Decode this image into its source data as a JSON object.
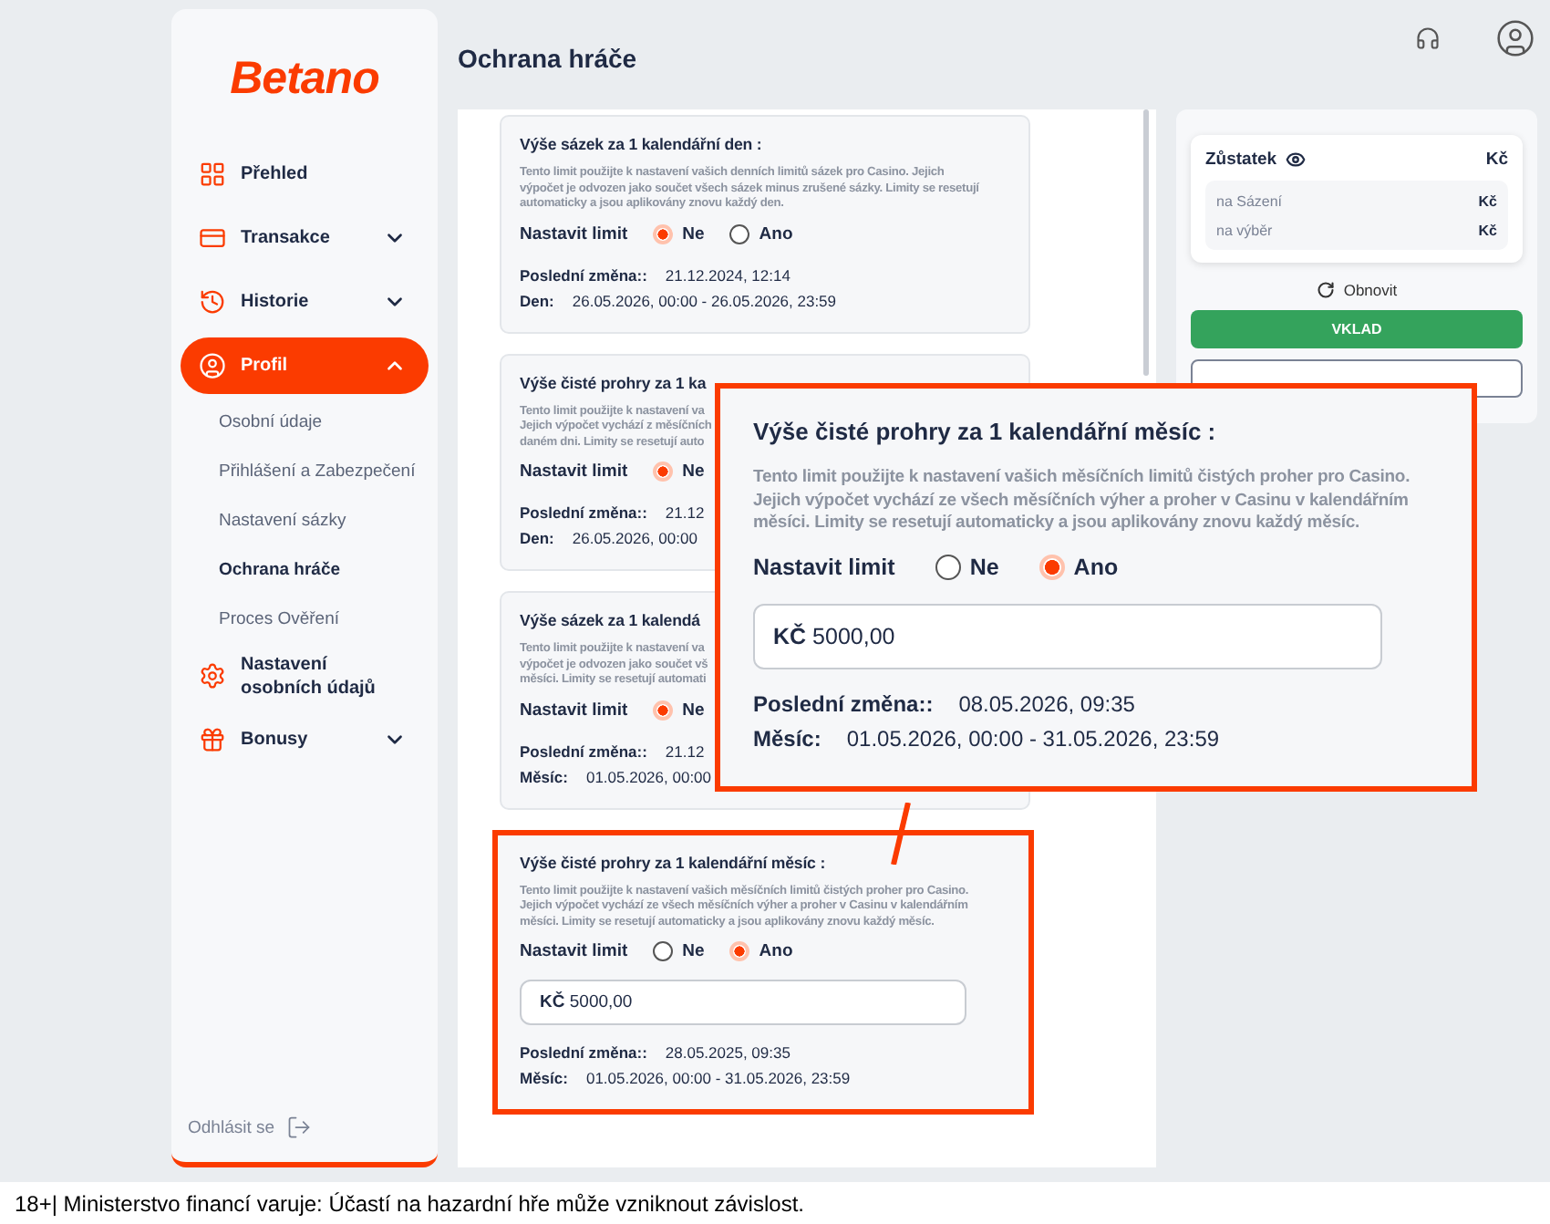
{
  "logo": "Betano",
  "nav": [
    {
      "label": "Přehled",
      "kind": "plain",
      "selected": false
    },
    {
      "label": "Transakce",
      "kind": "expandable",
      "expanded": false,
      "selected": false
    },
    {
      "label": "Historie",
      "kind": "expandable",
      "expanded": false,
      "selected": false
    },
    {
      "label": "Profil",
      "kind": "expandable",
      "expanded": true,
      "selected": true,
      "children": [
        {
          "label": "Osobní údaje",
          "selected": false
        },
        {
          "label": "Přihlášení a Zabezpečení",
          "selected": false
        },
        {
          "label": "Nastavení sázky",
          "selected": false
        },
        {
          "label": "Ochrana hráče",
          "selected": true
        },
        {
          "label": "Proces Ověření",
          "selected": false
        }
      ]
    },
    {
      "label": "Nastavení osobních údajů",
      "kind": "plain",
      "selected": false
    },
    {
      "label": "Bonusy",
      "kind": "expandable",
      "expanded": false,
      "selected": false
    }
  ],
  "logout": "Odhlásit se",
  "page_title": "Ochrana hráče",
  "cards": [
    {
      "title": "Výše sázek za 1 kalendářní den :",
      "highlighted": false,
      "description_lines": [
        "Tento limit použijte k nastavení vašich denních limitů sázek pro Casino. Jejich",
        "výpočet je odvozen jako součet všech sázek minus zrušené sázky. Limity se resetují",
        "automaticky a jsou aplikovány znovu každý den."
      ],
      "limit_label": "Nastavit limit",
      "options": [
        {
          "label": "Ne",
          "selected": true
        },
        {
          "label": "Ano",
          "selected": false
        }
      ],
      "rows": [
        {
          "label": "Poslední změna::",
          "value": "21.12.2024, 12:14"
        },
        {
          "label": "Den:",
          "value": "26.05.2026, 00:00 - 26.05.2026, 23:59"
        }
      ]
    },
    {
      "title": "Výše čisté prohry za 1 ka",
      "highlighted": false,
      "description_lines": [
        "Tento limit použijte k nastavení va",
        "Jejich výpočet vychází z měsíčních",
        "daném dni. Limity se resetují auto"
      ],
      "limit_label": "Nastavit limit",
      "options": [
        {
          "label": "Ne",
          "selected": true
        }
      ],
      "rows": [
        {
          "label": "Poslední změna::",
          "value": "21.12"
        },
        {
          "label": "Den:",
          "value": "26.05.2026, 00:00"
        }
      ]
    },
    {
      "title": "Výše sázek za 1 kalendá",
      "highlighted": false,
      "description_lines": [
        "Tento limit použijte k nastavení va",
        "výpočet je odvozen jako součet vš",
        "měsíci. Limity se resetují automati"
      ],
      "limit_label": "Nastavit limit",
      "options": [
        {
          "label": "Ne",
          "selected": true
        }
      ],
      "rows": [
        {
          "label": "Poslední změna::",
          "value": "21.12"
        },
        {
          "label": "Měsíc:",
          "value": "01.05.2026, 00:00"
        }
      ]
    },
    {
      "title": "Výše čisté prohry za 1 kalendářní měsíc :",
      "highlighted": true,
      "description_lines": [
        "Tento limit použijte k nastavení vašich měsíčních limitů čistých proher pro Casino.",
        "Jejich výpočet vychází ze všech měsíčních výher a proher v Casinu v kalendářním",
        "měsíci. Limity se resetují automaticky a jsou aplikovány znovu každý měsíc."
      ],
      "limit_label": "Nastavit limit",
      "options": [
        {
          "label": "Ne",
          "selected": false
        },
        {
          "label": "Ano",
          "selected": true
        }
      ],
      "amount": {
        "currency": "KČ",
        "value": "5000,00"
      },
      "rows": [
        {
          "label": "Poslední změna::",
          "value": "28.05.2025, 09:35"
        },
        {
          "label": "Měsíc:",
          "value": "01.05.2026, 00:00 - 31.05.2026, 23:59"
        }
      ]
    }
  ],
  "callout": {
    "title": "Výše čisté prohry za 1 kalendářní měsíc :",
    "highlighted": true,
    "description_lines": [
      "Tento limit použijte k nastavení vašich měsíčních limitů čistých proher pro Casino.",
      "Jejich výpočet vychází ze všech měsíčních výher a proher v Casinu v kalendářním",
      "měsíci. Limity se resetují automaticky a jsou aplikovány znovu každý měsíc."
    ],
    "limit_label": "Nastavit limit",
    "options": [
      {
        "label": "Ne",
        "selected": false
      },
      {
        "label": "Ano",
        "selected": true
      }
    ],
    "amount": {
      "currency": "KČ",
      "value": "5000,00"
    },
    "rows": [
      {
        "label": "Poslední změna::",
        "value": "08.05.2026, 09:35"
      },
      {
        "label": "Měsíc:",
        "value": "01.05.2026, 00:00 - 31.05.2026, 23:59"
      }
    ]
  },
  "balance": {
    "title": "Zůstatek",
    "currency": "Kč",
    "rows": [
      {
        "label": "na Sázení",
        "value": "Kč"
      },
      {
        "label": "na výběr",
        "value": "Kč"
      }
    ]
  },
  "refresh": "Obnovit",
  "deposit": "VKLAD",
  "footer": "18+| Ministerstvo financí varuje: Účastí na hazardní hře může vzniknout závislost."
}
